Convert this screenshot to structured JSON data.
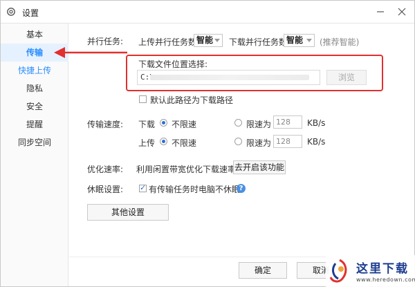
{
  "window": {
    "title": "设置"
  },
  "sidebar": {
    "items": [
      {
        "label": "基本"
      },
      {
        "label": "传输"
      },
      {
        "label": "快捷上传"
      },
      {
        "label": "隐私"
      },
      {
        "label": "安全"
      },
      {
        "label": "提醒"
      },
      {
        "label": "同步空间"
      }
    ],
    "active_index": 1
  },
  "parallel": {
    "label": "并行任务:",
    "upload_label": "上传并行任务数",
    "upload_value": "智能",
    "download_label": "下载并行任务数",
    "download_value": "智能",
    "hint": "(推荐智能)"
  },
  "download_location": {
    "label": "下载文件位置选择:",
    "path_prefix": "C:\\",
    "browse_label": "浏览",
    "default_checkbox_label": "默认此路径为下载路径",
    "default_checked": false
  },
  "speed": {
    "label": "传输速度:",
    "download": {
      "label": "下载",
      "unlimited_label": "不限速",
      "limit_label": "限速为",
      "limit_value": "128",
      "unit": "KB/s",
      "unlimited_selected": true
    },
    "upload": {
      "label": "上传",
      "unlimited_label": "不限速",
      "limit_label": "限速为",
      "limit_value": "128",
      "unit": "KB/s",
      "unlimited_selected": true
    }
  },
  "optimize": {
    "label": "优化速率:",
    "description": "利用闲置带宽优化下载速率",
    "button_label": "去开启该功能"
  },
  "sleep": {
    "label": "休眠设置:",
    "checkbox_label": "有传输任务时电脑不休眠",
    "checked": true,
    "help_symbol": "?"
  },
  "other_settings_label": "其他设置",
  "footer": {
    "ok_label": "确定",
    "cancel_label": "取消"
  },
  "watermark": {
    "cn_text": "这里下载",
    "url_text": "www.heredown.com"
  },
  "colors": {
    "accent": "#2b8eff",
    "highlight": "#e0302f",
    "arrow": "#e0302f"
  }
}
